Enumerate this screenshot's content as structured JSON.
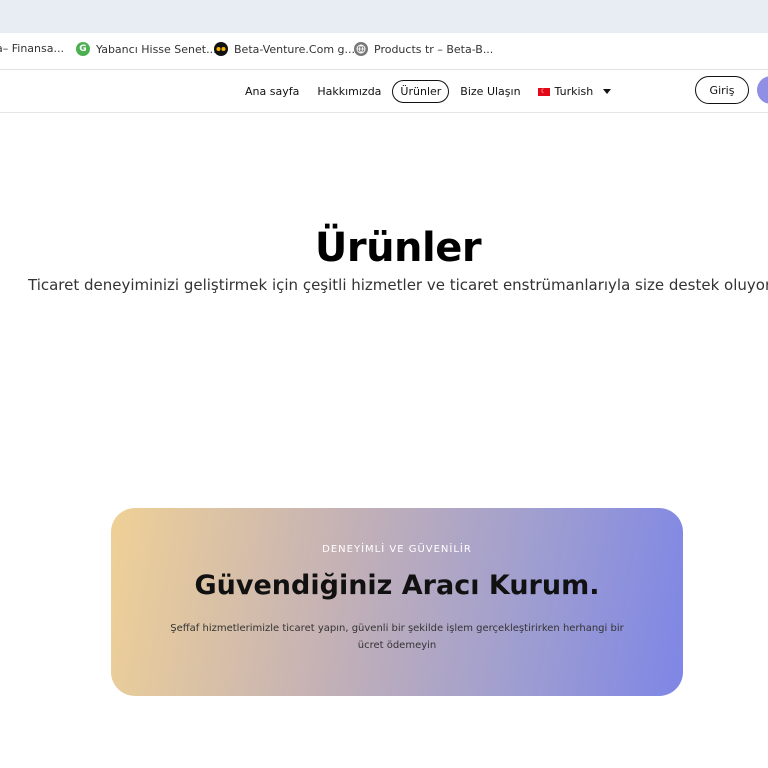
{
  "bookmarks": [
    {
      "label": "a– Finansa...",
      "icon": "none"
    },
    {
      "label": "Yabancı Hisse Senet...",
      "icon": "green-g-icon"
    },
    {
      "label": "Beta-Venture.Com g...",
      "icon": "eyes-icon"
    },
    {
      "label": "Products tr – Beta-B...",
      "icon": "globe-icon"
    }
  ],
  "nav": {
    "items": [
      {
        "label": "Ana sayfa"
      },
      {
        "label": "Hakkımızda"
      },
      {
        "label": "Ürünler",
        "active": true
      },
      {
        "label": "Bize Ulaşın"
      }
    ],
    "language": "Turkish",
    "login_label": "Giriş"
  },
  "hero": {
    "title": "Ürünler",
    "subtitle": "Ticaret deneyiminizi geliştirmek için çeşitli hizmetler ve ticaret enstrümanlarıyla size destek oluyoruz."
  },
  "banner": {
    "kicker": "DENEYİMLİ VE GÜVENİLİR",
    "title": "Güvendiğiniz Aracı Kurum.",
    "text": "Şeffaf hizmetlerimizle ticaret yapın, güvenli bir şekilde işlem gerçekleştirirken herhangi bir ücret ödemeyin"
  },
  "colors": {
    "accent": "#8f8fe6",
    "gradient_start": "#efd196",
    "gradient_end": "#7e86e6"
  }
}
